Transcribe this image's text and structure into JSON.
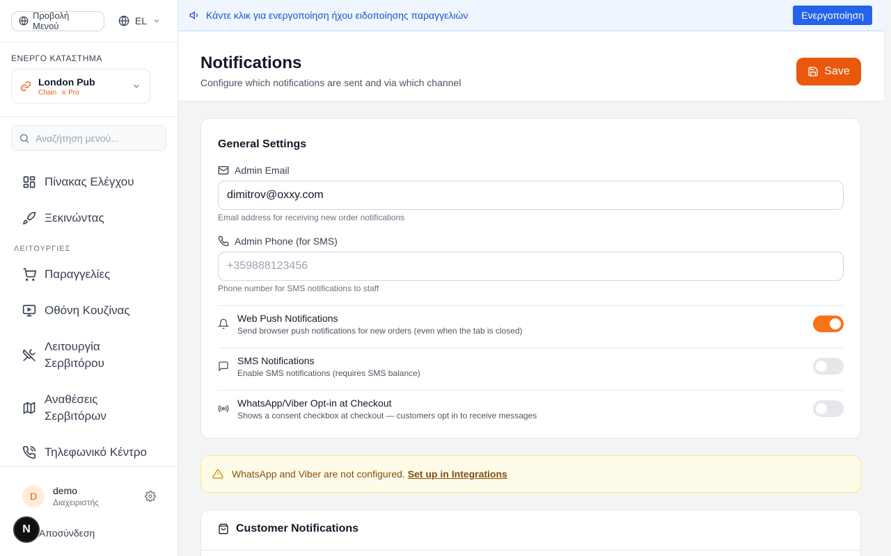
{
  "sidebar": {
    "menu_view": "Προβολή Μενού",
    "language": "EL",
    "active_store_label": "ΕΝΕΡΓΟ ΚΑΤΑΣΤΗΜΑ",
    "store_name": "London Pub",
    "store_type": "Chain",
    "store_plan": "Pro",
    "search_placeholder": "Αναζήτηση μενού...",
    "nav": {
      "dashboard": "Πίνακας Ελέγχου",
      "getting_started": "Ξεκινώντας",
      "group_operations": "ΛΕΙΤΟΥΡΓΙΕΣ",
      "orders": "Παραγγελίες",
      "kitchen": "Οθόνη Κουζίνας",
      "waiter_line1": "Λειτουργία",
      "waiter_line2": "Σερβιτόρου",
      "assign_line1": "Αναθέσεις",
      "assign_line2": "Σερβιτόρων",
      "call_center": "Τηλεφωνικό Κέντρο"
    },
    "user": {
      "initial": "D",
      "name": "demo",
      "role": "Διαχειριστής",
      "logout": "Αποσύνδεση"
    },
    "badge": "N"
  },
  "banner": {
    "text": "Κάντε κλικ για ενεργοποίηση ήχου ειδοποίησης παραγγελιών",
    "button": "Ενεργοποίηση"
  },
  "header": {
    "title": "Notifications",
    "subtitle": "Configure which notifications are sent and via which channel",
    "save": "Save"
  },
  "general": {
    "title": "General Settings",
    "email_label": "Admin Email",
    "email_value": "dimitrov@oxxy.com",
    "email_hint": "Email address for receiving new order notifications",
    "phone_label": "Admin Phone (for SMS)",
    "phone_placeholder": "+359888123456",
    "phone_hint": "Phone number for SMS notifications to staff",
    "toggles": [
      {
        "title": "Web Push Notifications",
        "desc": "Send browser push notifications for new orders (even when the tab is closed)",
        "on": true
      },
      {
        "title": "SMS Notifications",
        "desc": "Enable SMS notifications (requires SMS balance)",
        "on": false
      },
      {
        "title": "WhatsApp/Viber Opt-in at Checkout",
        "desc": "Shows a consent checkbox at checkout — customers opt in to receive messages",
        "on": false
      }
    ]
  },
  "warning": {
    "text": "WhatsApp and Viber are not configured. ",
    "link": "Set up in Integrations"
  },
  "customer": {
    "title": "Customer Notifications"
  },
  "colors": {
    "accent": "#ea580c",
    "banner_blue": "#2563eb"
  }
}
